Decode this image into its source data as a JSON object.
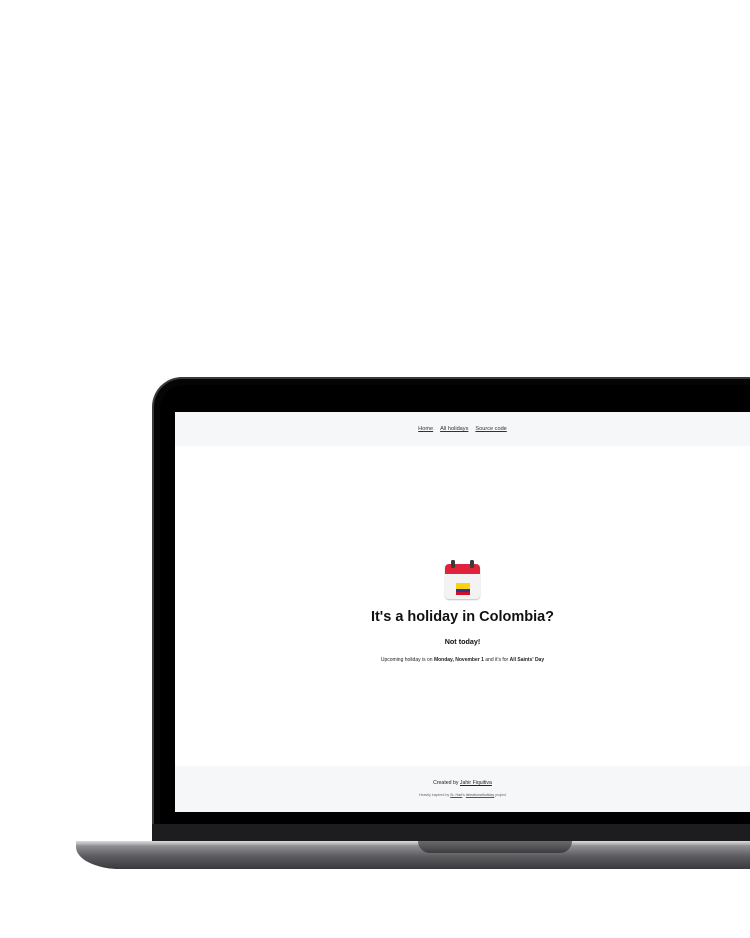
{
  "nav": {
    "items": [
      {
        "label": "Home"
      },
      {
        "label": "All holidays"
      },
      {
        "label": "Source code"
      }
    ]
  },
  "hero": {
    "icon": "calendar-colombia-flag-icon",
    "title": "It's a holiday in Colombia?",
    "answer": "Not today!",
    "upcoming_prefix": "Upcoming holiday is on ",
    "upcoming_date": "Monday, November 1",
    "upcoming_middle": " and it's for ",
    "upcoming_name": "All Saints' Day"
  },
  "footer": {
    "created_prefix": "Created by ",
    "author": "Jahir Fiquitiva",
    "inspired_prefix": "Heavily inspired by ",
    "inspired_person": "Sr. Hart",
    "inspired_middle": "'s ",
    "inspired_project": "isitnationalholiday",
    "inspired_suffix": " project"
  },
  "colors": {
    "calendar_red": "#e0233a",
    "flag_yellow": "#fcd116",
    "flag_blue": "#2a3b8f",
    "flag_red": "#ce1126",
    "nav_bg": "#f6f7f8"
  }
}
